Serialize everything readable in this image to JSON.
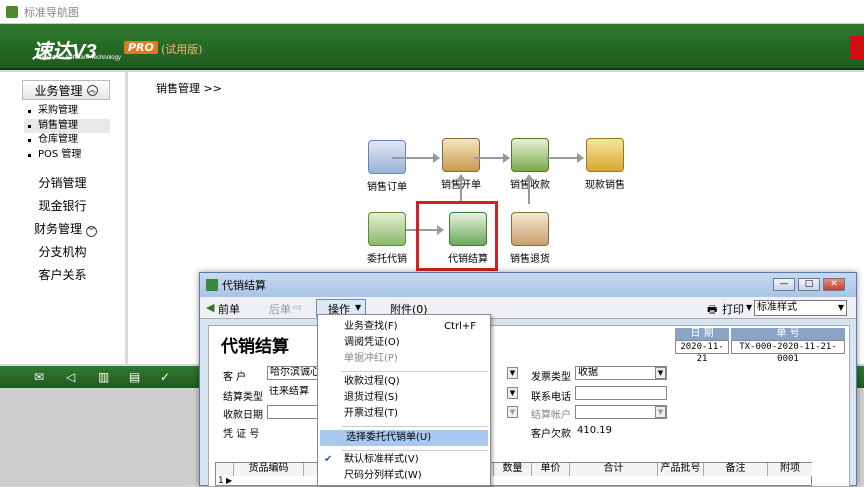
{
  "window": {
    "title": "标准导航图"
  },
  "brand": {
    "logo": "速达V3",
    "logo_sub": "Superdata Software Technology",
    "pro": "PRO",
    "trial": "(试用版)"
  },
  "sidebar": {
    "business_header": "业务管理",
    "sub_items": [
      {
        "label": "采购管理"
      },
      {
        "label": "销售管理"
      },
      {
        "label": "仓库管理"
      },
      {
        "label": "POS 管理"
      }
    ],
    "nav": [
      {
        "label": "分销管理"
      },
      {
        "label": "现金银行"
      },
      {
        "label": "财务管理"
      },
      {
        "label": "分支机构"
      },
      {
        "label": "客户关系"
      }
    ]
  },
  "main": {
    "breadcrumb": "销售管理 >>",
    "flow": {
      "order": "销售订单",
      "invoice": "销售开单",
      "collect": "销售收款",
      "cash": "现款销售",
      "consign": "委托代销",
      "settle": "代销结算",
      "return": "销售退货"
    }
  },
  "dialog": {
    "title": "代销结算",
    "toolbar": {
      "prev": "前单",
      "next": "后单",
      "ops": "操作",
      "attach": "附件(0)",
      "print": "打印",
      "style": "标准样式"
    },
    "heading": "代销结算",
    "date_label": "日 期",
    "date_value": "2020-11-21",
    "no_label": "单 号",
    "no_value": "TX-000-2020-11-21-0001",
    "fields": {
      "customer_label": "客 户",
      "customer_value": "哈尔滨诚心公",
      "settle_type_label": "结算类型",
      "settle_type_value": "往来结算",
      "collect_date_label": "收款日期",
      "voucher_label": "凭 证 号",
      "invoice_type_label": "发票类型",
      "invoice_type_value": "收据",
      "phone_label": "联系电话",
      "account_label": "结算帐户",
      "debt_label": "客户欠款",
      "debt_value": "410.19"
    },
    "grid_headers": [
      "货品编码",
      "数量",
      "单价",
      "合计",
      "产品批号",
      "备注",
      "附项"
    ],
    "grid_row_num": "1"
  },
  "menu": {
    "items": [
      {
        "label": "业务查找(F)",
        "shortcut": "Ctrl+F"
      },
      {
        "label": "调阅凭证(O)"
      },
      {
        "label": "单据冲红(P)"
      },
      {
        "label": "收款过程(Q)"
      },
      {
        "label": "退货过程(S)"
      },
      {
        "label": "开票过程(T)"
      },
      {
        "label": "选择委托代销单(U)"
      },
      {
        "label": "默认标准样式(V)"
      },
      {
        "label": "尺码分列样式(W)"
      }
    ]
  }
}
